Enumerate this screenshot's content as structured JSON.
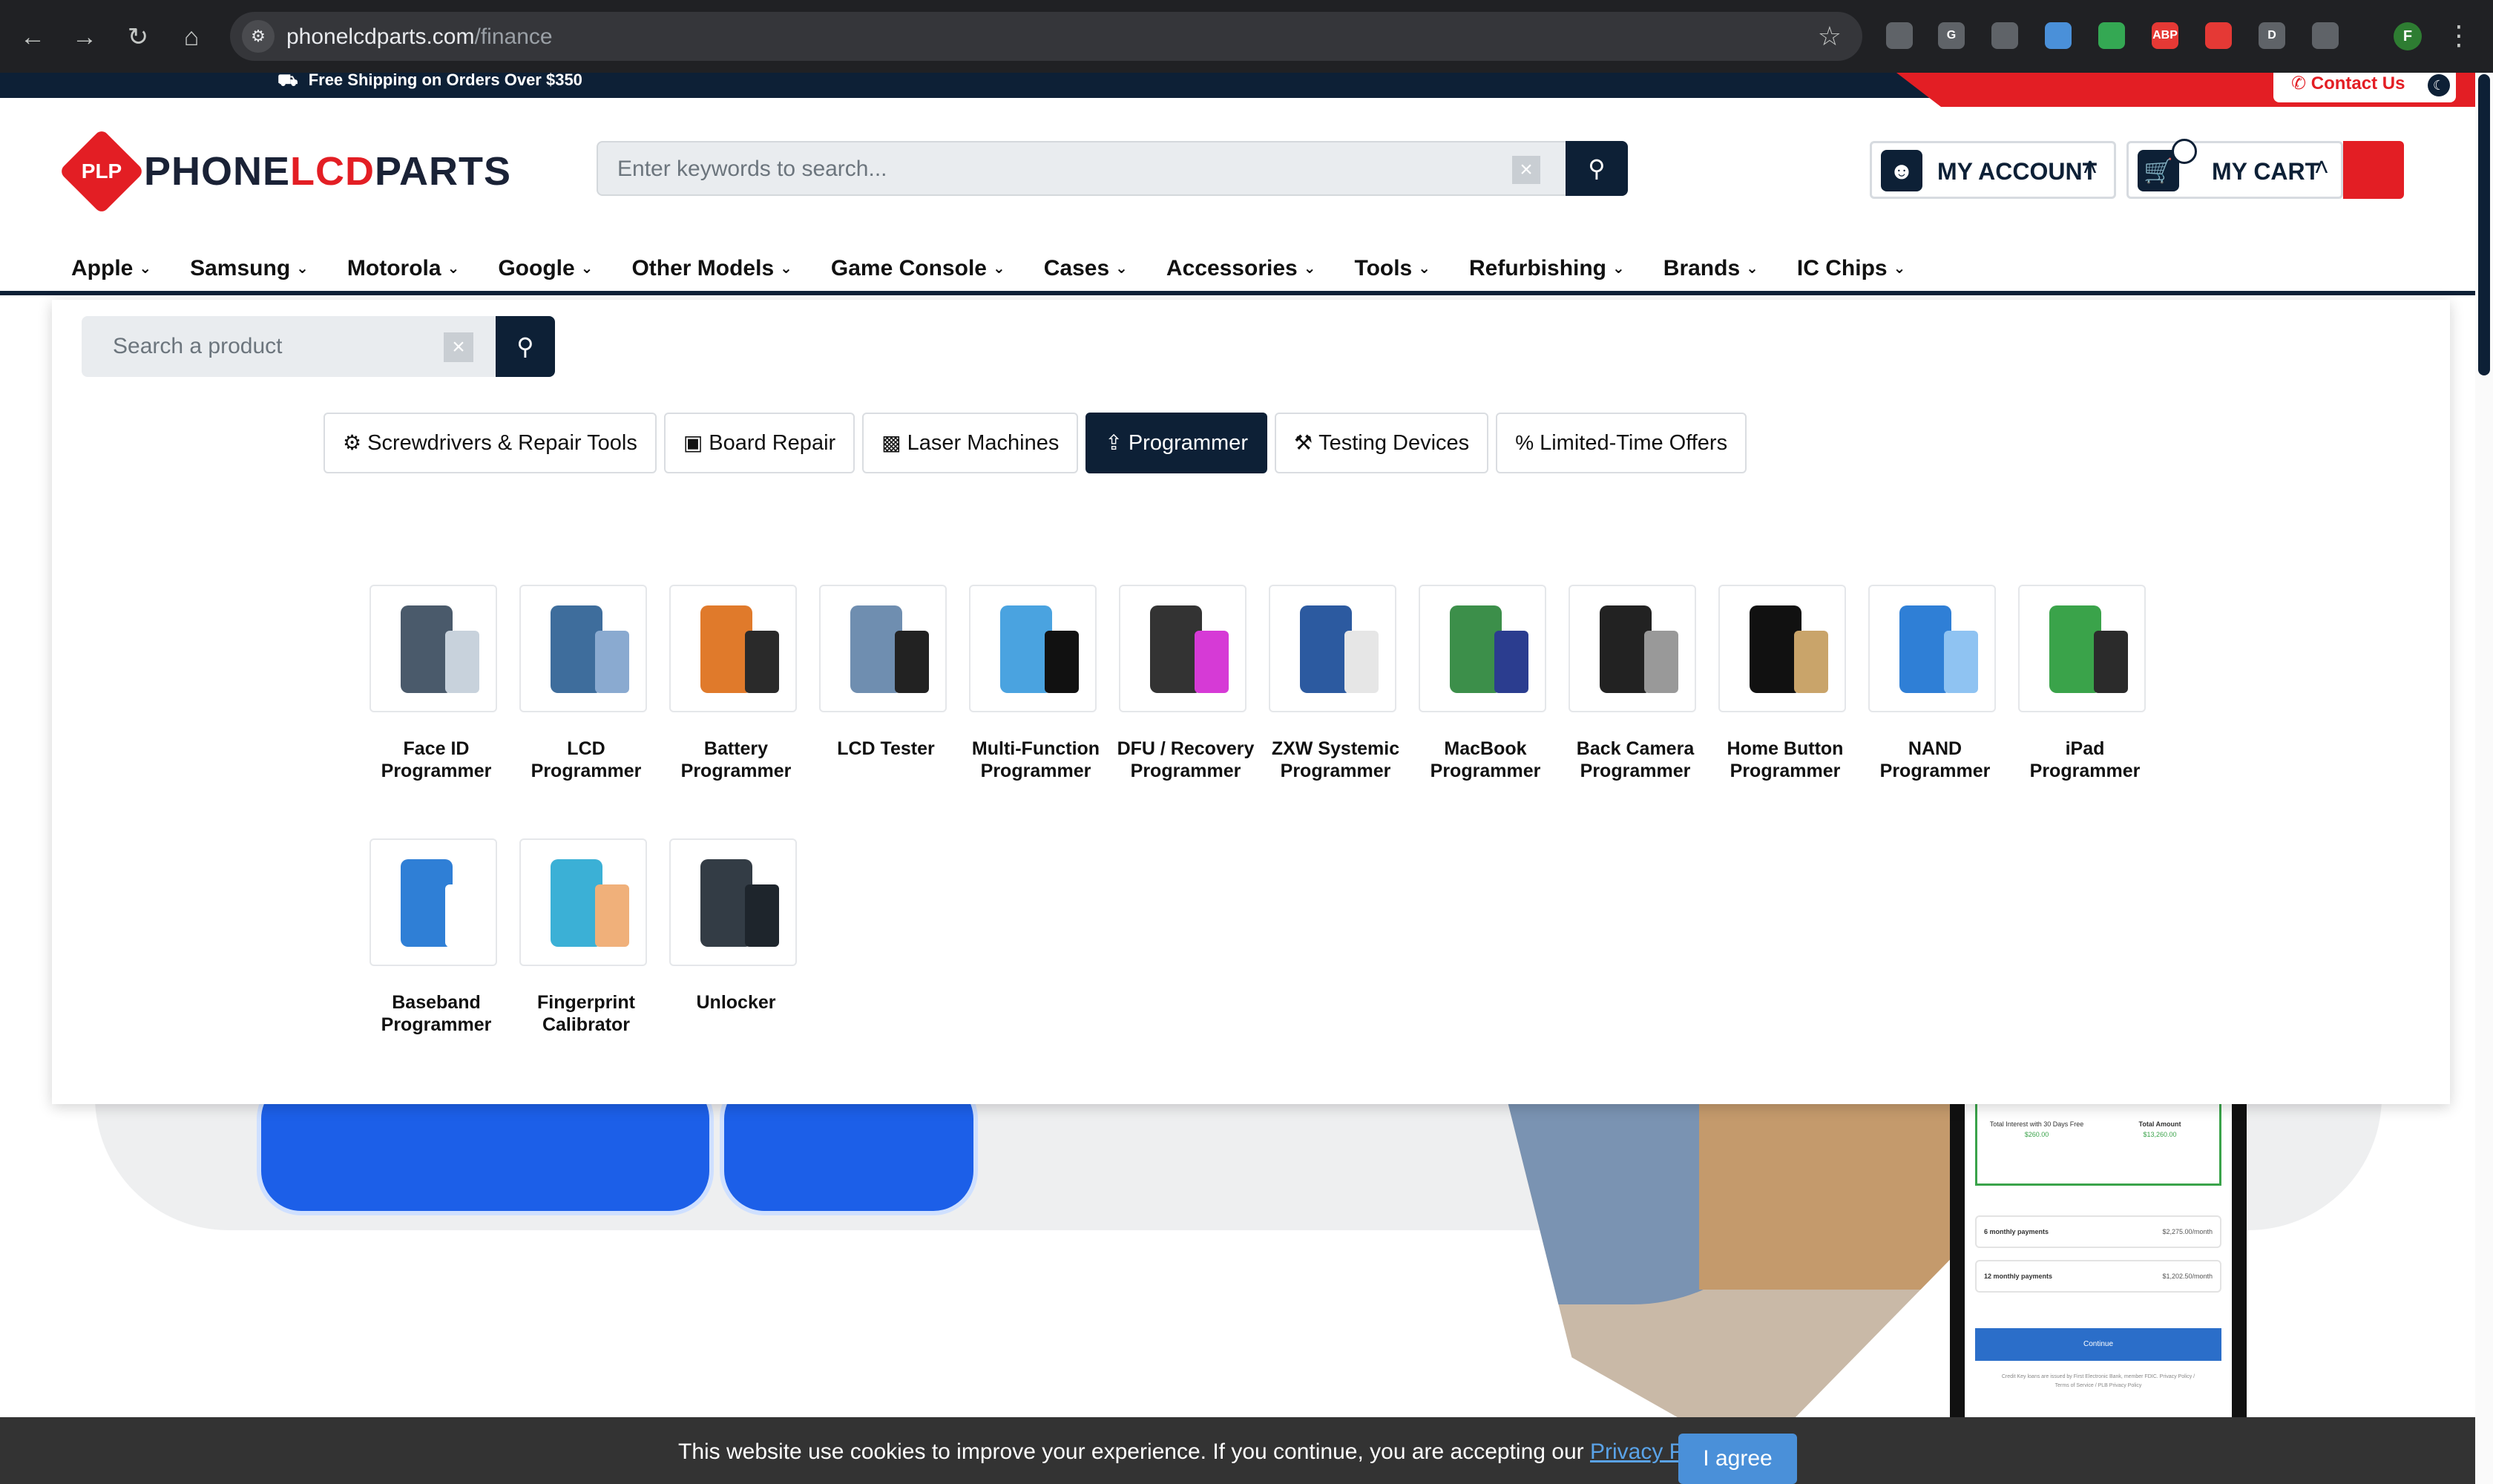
{
  "browser": {
    "url_domain": "phonelcdparts.com",
    "url_path": "/finance",
    "profile_initial": "F",
    "extensions": [
      {
        "name": "translate-extension-icon",
        "label": "",
        "color": "#5f6368"
      },
      {
        "name": "grammarly-extension-icon",
        "label": "G",
        "color": "#5f6368"
      },
      {
        "name": "printer-extension-icon",
        "label": "",
        "color": "#5f6368"
      },
      {
        "name": "cloud-extension-icon",
        "label": "",
        "color": "#4a90d9"
      },
      {
        "name": "green-extension-icon",
        "label": "",
        "color": "#34a853"
      },
      {
        "name": "adblock-plus-icon",
        "label": "ABP",
        "color": "#e53935"
      },
      {
        "name": "pokeball-extension-icon",
        "label": "",
        "color": "#e53935"
      },
      {
        "name": "dashlane-extension-icon",
        "label": "D",
        "color": "#5f6368"
      },
      {
        "name": "puzzle-extensions-icon",
        "label": "",
        "color": "#5f6368"
      }
    ]
  },
  "topbar": {
    "shipping_text": "Free Shipping on Orders Over $350",
    "contact_label": "Contact Us"
  },
  "header": {
    "logo_mark": "PLP",
    "logo_word_1": "PHONE",
    "logo_word_2": "LCD",
    "logo_word_3": "PARTS",
    "search_placeholder": "Enter keywords to search...",
    "account_label": "MY ACCOUNT",
    "cart_label": "MY CART"
  },
  "nav": {
    "categories": [
      "Apple",
      "Samsung",
      "Motorola",
      "Google",
      "Other Models",
      "Game Console",
      "Cases",
      "Accessories",
      "Tools",
      "Refurbishing",
      "Brands",
      "IC Chips"
    ]
  },
  "mega_menu": {
    "search_placeholder": "Search a product",
    "tabs": [
      {
        "label": "Screwdrivers & Repair Tools",
        "icon": "gear-icon",
        "active": false
      },
      {
        "label": "Board Repair",
        "icon": "circuit-board-icon",
        "active": false
      },
      {
        "label": "Laser Machines",
        "icon": "laser-machine-icon",
        "active": false
      },
      {
        "label": "Programmer",
        "icon": "upload-icon",
        "active": true
      },
      {
        "label": "Testing Devices",
        "icon": "wrench-icon",
        "active": false
      },
      {
        "label": "Limited-Time Offers",
        "icon": "percent-icon",
        "active": false
      }
    ],
    "products": [
      {
        "name": "Face ID Programmer",
        "line1": "Face ID",
        "line2": "Programmer"
      },
      {
        "name": "LCD Programmer",
        "line1": "LCD",
        "line2": "Programmer"
      },
      {
        "name": "Battery Programmer",
        "line1": "Battery",
        "line2": "Programmer"
      },
      {
        "name": "LCD Tester",
        "line1": "LCD Tester",
        "line2": ""
      },
      {
        "name": "Multi-Function Programmer",
        "line1": "Multi-Function",
        "line2": "Programmer"
      },
      {
        "name": "DFU / Recovery Programmer",
        "line1": "DFU / Recovery",
        "line2": "Programmer"
      },
      {
        "name": "ZXW Systemic Programmer",
        "line1": "ZXW Systemic",
        "line2": "Programmer"
      },
      {
        "name": "MacBook Programmer",
        "line1": "MacBook",
        "line2": "Programmer"
      },
      {
        "name": "Back Camera Programmer",
        "line1": "Back Camera",
        "line2": "Programmer"
      },
      {
        "name": "Home Button Programmer",
        "line1": "Home Button",
        "line2": "Programmer"
      },
      {
        "name": "NAND Programmer",
        "line1": "NAND",
        "line2": "Programmer"
      },
      {
        "name": "iPad Programmer",
        "line1": "iPad",
        "line2": "Programmer"
      },
      {
        "name": "Baseband Programmer",
        "line1": "Baseband",
        "line2": "Programmer"
      },
      {
        "name": "Fingerprint Calibrator",
        "line1": "Fingerprint",
        "line2": "Calibrator"
      },
      {
        "name": "Unlocker",
        "line1": "Unlocker",
        "line2": ""
      }
    ]
  },
  "phone_mock": {
    "total_interest_label": "Total Interest with 30 Days Free",
    "total_interest_value": "$260.00",
    "total_amount_label": "Total Amount",
    "total_amount_value": "$13,260.00",
    "row1_label": "6 monthly payments",
    "row1_value": "$2,275.00/month",
    "row2_label": "12 monthly payments",
    "row2_value": "$1,202.50/month",
    "continue_label": "Continue",
    "fine_print": "Credit Key loans are issued by First Electronic Bank, member FDIC. Privacy Policy / Terms of Service / PLB Privacy Policy"
  },
  "cookie": {
    "message": "This website use cookies to improve your experience. If you continue, you are accepting our ",
    "link_text": "Privacy Policy",
    "suffix": ".",
    "agree_label": "I agree"
  },
  "colors": {
    "navy": "#0d2036",
    "brand_red": "#e31e24",
    "hero_blue": "#1c5fe8",
    "cookie_button": "#4a90d9"
  }
}
